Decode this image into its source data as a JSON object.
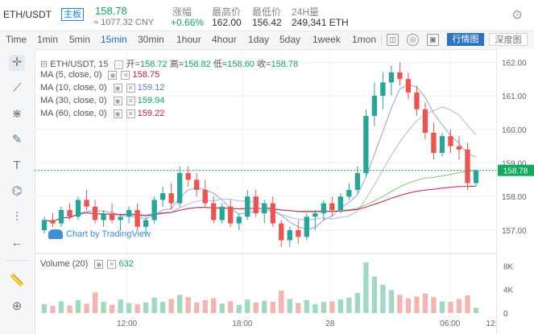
{
  "header": {
    "pair": "ETH/USDT",
    "board": "主板",
    "last_price": "158.78",
    "cny_price": "≈ 1077.32 CNY",
    "change_label": "涨幅",
    "change_value": "+0.66%",
    "high_label": "最高价",
    "high_value": "162.00",
    "low_label": "最低价",
    "low_value": "156.42",
    "volume_label": "24H量",
    "volume_value": "249,341 ETH",
    "settings_icon": "gear-icon"
  },
  "toolbar": {
    "intervals": [
      "Time",
      "1min",
      "5min",
      "15min",
      "30min",
      "1hour",
      "4hour",
      "1day",
      "5day",
      "1week",
      "1mon"
    ],
    "active_interval": "15min",
    "line_chart_btn": "行情图",
    "depth_chart_btn": "深度图"
  },
  "legend": {
    "title": "ETH/USDT, 15",
    "open_label": "开=",
    "open": "158.72",
    "high_label": "高=",
    "high": "158.82",
    "low_label": "低=",
    "low": "158.60",
    "close_label": "收=",
    "close": "158.78",
    "ma5": {
      "label": "MA (5, close, 0)",
      "value": "158.75"
    },
    "ma10": {
      "label": "MA (10, close, 0)",
      "value": "159.12"
    },
    "ma30": {
      "label": "MA (30, close, 0)",
      "value": "159.94"
    },
    "ma60": {
      "label": "MA (60, close, 0)",
      "value": "159.22"
    },
    "volume": {
      "label": "Volume (20)",
      "value": "632"
    }
  },
  "watermark": "Chart by TradingView",
  "colors": {
    "up": "#26a69a",
    "up_body": "#11a860",
    "down": "#ef5350",
    "ma5": "#c2185b",
    "ma10": "#8fa3d9",
    "ma30": "#7cc776",
    "ma60": "#c2185b",
    "accent": "#2b72c4"
  },
  "chart_data": {
    "type": "candlestick",
    "price_axis_ticks": [
      "162.00",
      "161.00",
      "160.00",
      "159.00",
      "158.00",
      "157.00"
    ],
    "current_price_tag": "158.78",
    "volume_axis_ticks": [
      "8K",
      "4K",
      "0"
    ],
    "time_ticks": [
      "12:00",
      "18:00",
      "28",
      "06:00",
      "12:"
    ],
    "ylim": [
      156.4,
      162.2
    ],
    "candles": [
      [
        157.0,
        157.4,
        156.9,
        157.3
      ],
      [
        157.3,
        157.5,
        157.1,
        157.2
      ],
      [
        157.2,
        157.7,
        157.1,
        157.6
      ],
      [
        157.6,
        157.8,
        157.3,
        157.4
      ],
      [
        157.4,
        158.0,
        157.3,
        157.9
      ],
      [
        157.9,
        158.2,
        157.6,
        157.7
      ],
      [
        157.7,
        157.9,
        157.2,
        157.3
      ],
      [
        157.3,
        157.6,
        157.1,
        157.5
      ],
      [
        157.5,
        157.8,
        157.2,
        157.3
      ],
      [
        157.3,
        157.5,
        157.0,
        157.4
      ],
      [
        157.4,
        157.7,
        157.2,
        157.6
      ],
      [
        157.6,
        157.8,
        157.0,
        157.1
      ],
      [
        157.1,
        157.4,
        156.9,
        157.3
      ],
      [
        157.3,
        158.0,
        157.2,
        157.9
      ],
      [
        157.9,
        158.3,
        157.7,
        158.1
      ],
      [
        158.1,
        158.4,
        157.6,
        157.8
      ],
      [
        157.8,
        158.9,
        157.7,
        158.7
      ],
      [
        158.7,
        158.9,
        158.3,
        158.5
      ],
      [
        158.5,
        158.7,
        158.0,
        158.2
      ],
      [
        158.2,
        158.5,
        157.7,
        157.8
      ],
      [
        157.8,
        158.0,
        157.2,
        157.3
      ],
      [
        157.3,
        157.8,
        157.2,
        157.7
      ],
      [
        157.7,
        157.9,
        157.1,
        157.2
      ],
      [
        157.2,
        157.5,
        157.0,
        157.4
      ],
      [
        157.4,
        158.2,
        157.3,
        158.0
      ],
      [
        158.0,
        158.2,
        157.4,
        157.5
      ],
      [
        157.5,
        157.9,
        157.2,
        157.8
      ],
      [
        157.8,
        158.0,
        157.1,
        157.2
      ],
      [
        157.2,
        157.3,
        156.5,
        156.7
      ],
      [
        156.7,
        157.1,
        156.5,
        157.0
      ],
      [
        157.0,
        157.3,
        156.6,
        156.8
      ],
      [
        156.8,
        157.5,
        156.7,
        157.4
      ],
      [
        157.4,
        157.6,
        157.0,
        157.5
      ],
      [
        157.5,
        157.9,
        157.3,
        157.8
      ],
      [
        157.8,
        158.0,
        157.4,
        157.6
      ],
      [
        157.6,
        158.1,
        157.5,
        158.0
      ],
      [
        158.0,
        158.4,
        157.9,
        158.2
      ],
      [
        158.2,
        158.9,
        158.1,
        158.7
      ],
      [
        158.7,
        160.6,
        158.6,
        160.4
      ],
      [
        160.4,
        161.4,
        160.1,
        161.0
      ],
      [
        161.0,
        161.7,
        160.6,
        161.4
      ],
      [
        161.4,
        161.9,
        161.0,
        161.7
      ],
      [
        161.7,
        162.0,
        161.3,
        161.5
      ],
      [
        161.5,
        161.7,
        160.9,
        161.1
      ],
      [
        161.1,
        161.3,
        160.4,
        160.6
      ],
      [
        160.6,
        160.8,
        159.7,
        159.9
      ],
      [
        159.9,
        160.2,
        159.1,
        159.3
      ],
      [
        159.3,
        159.9,
        159.2,
        159.8
      ],
      [
        159.8,
        160.0,
        159.3,
        159.5
      ],
      [
        159.5,
        159.8,
        159.1,
        159.4
      ],
      [
        159.4,
        159.6,
        158.2,
        158.4
      ],
      [
        158.4,
        158.8,
        158.3,
        158.78
      ]
    ],
    "volumes": [
      1.5,
      1.2,
      2.0,
      1.3,
      2.2,
      1.6,
      3.5,
      1.9,
      1.4,
      2.3,
      1.7,
      1.5,
      1.8,
      2.6,
      1.9,
      2.4,
      3.1,
      2.7,
      1.8,
      2.2,
      2.5,
      1.6,
      2.0,
      1.4,
      2.3,
      1.8,
      2.1,
      1.9,
      3.8,
      2.4,
      1.7,
      2.2,
      1.5,
      1.9,
      2.0,
      2.3,
      2.6,
      3.4,
      8.6,
      6.2,
      4.8,
      3.9,
      3.1,
      2.5,
      2.8,
      3.3,
      2.7,
      2.0,
      1.9,
      2.4,
      3.0,
      0.9
    ],
    "volume_ylim": [
      0,
      9
    ]
  }
}
